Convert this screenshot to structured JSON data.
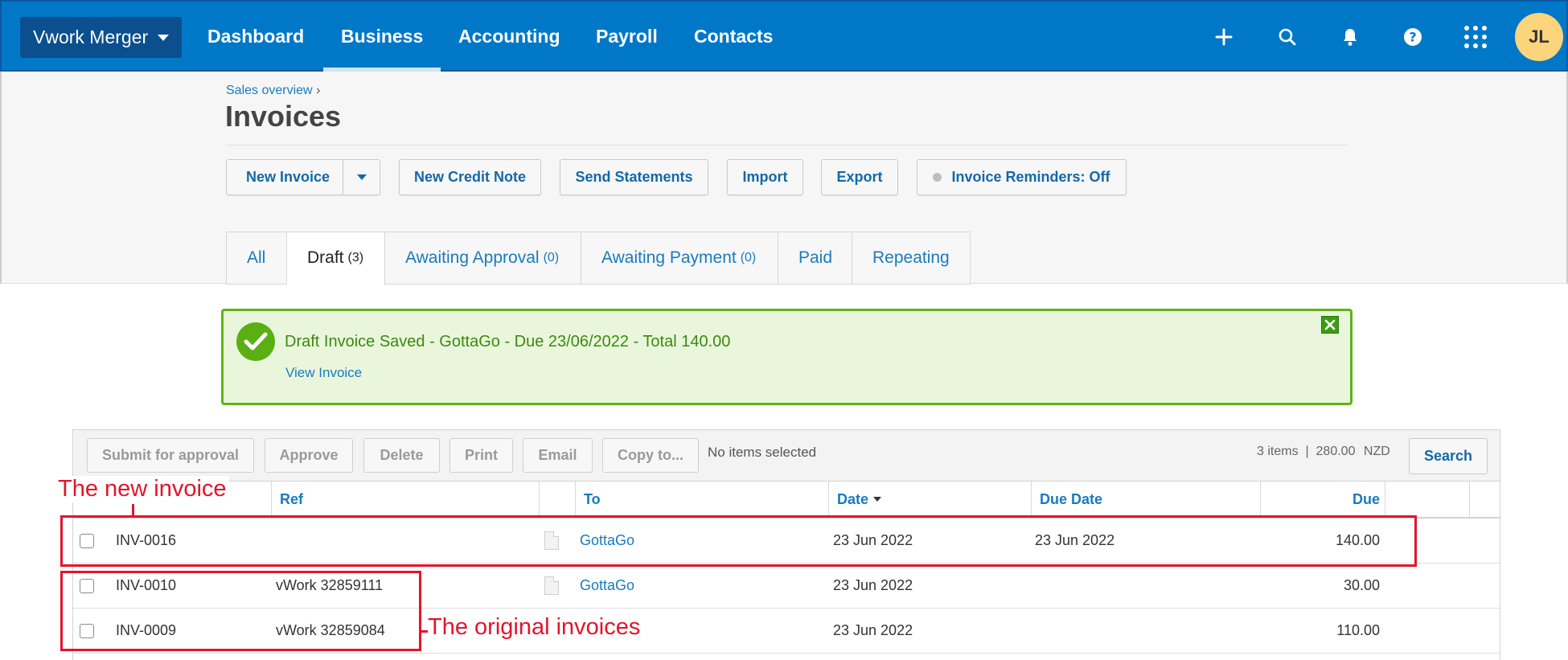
{
  "nav": {
    "org": "Vwork Merger",
    "items": [
      "Dashboard",
      "Business",
      "Accounting",
      "Payroll",
      "Contacts"
    ],
    "active": "Business",
    "avatar": "JL",
    "icons": [
      "plus-icon",
      "search-icon",
      "bell-icon",
      "help-icon",
      "apps-grid-icon"
    ]
  },
  "header": {
    "breadcrumb": "Sales overview",
    "breadcrumb_sep": "›",
    "title": "Invoices"
  },
  "actions": {
    "new_invoice": "New Invoice",
    "new_credit_note": "New Credit Note",
    "send_statements": "Send Statements",
    "import": "Import",
    "export": "Export",
    "reminders": "Invoice Reminders: Off"
  },
  "tabs": [
    {
      "label": "All",
      "count": ""
    },
    {
      "label": "Draft",
      "count": "(3)"
    },
    {
      "label": "Awaiting Approval",
      "count": "(0)"
    },
    {
      "label": "Awaiting Payment",
      "count": "(0)"
    },
    {
      "label": "Paid",
      "count": ""
    },
    {
      "label": "Repeating",
      "count": ""
    }
  ],
  "notice": {
    "message": "Draft Invoice Saved - GottaGo - Due 23/06/2022 - Total 140.00",
    "link": "View Invoice"
  },
  "toolbar": {
    "submit": "Submit for approval",
    "approve": "Approve",
    "delete": "Delete",
    "print": "Print",
    "email": "Email",
    "copy": "Copy to...",
    "selection": "No items selected",
    "items_count": "3 items",
    "total": "280.00",
    "currency": "NZD",
    "search": "Search"
  },
  "table": {
    "columns": [
      "Ref",
      "To",
      "Date",
      "Due Date",
      "Due"
    ],
    "rows": [
      {
        "number": "INV-0016",
        "ref": "",
        "to": "GottaGo",
        "date": "23 Jun 2022",
        "due_date": "23 Jun 2022",
        "due": "140.00"
      },
      {
        "number": "INV-0010",
        "ref": "vWork 32859111",
        "to": "GottaGo",
        "date": "23 Jun 2022",
        "due_date": "",
        "due": "30.00"
      },
      {
        "number": "INV-0009",
        "ref": "vWork 32859084",
        "to": "",
        "date": "23 Jun 2022",
        "due_date": "",
        "due": "110.00"
      }
    ]
  },
  "annotations": {
    "new_invoice": "The new invoice",
    "original_invoices": "The original invoices",
    "color": "#e3142b"
  }
}
